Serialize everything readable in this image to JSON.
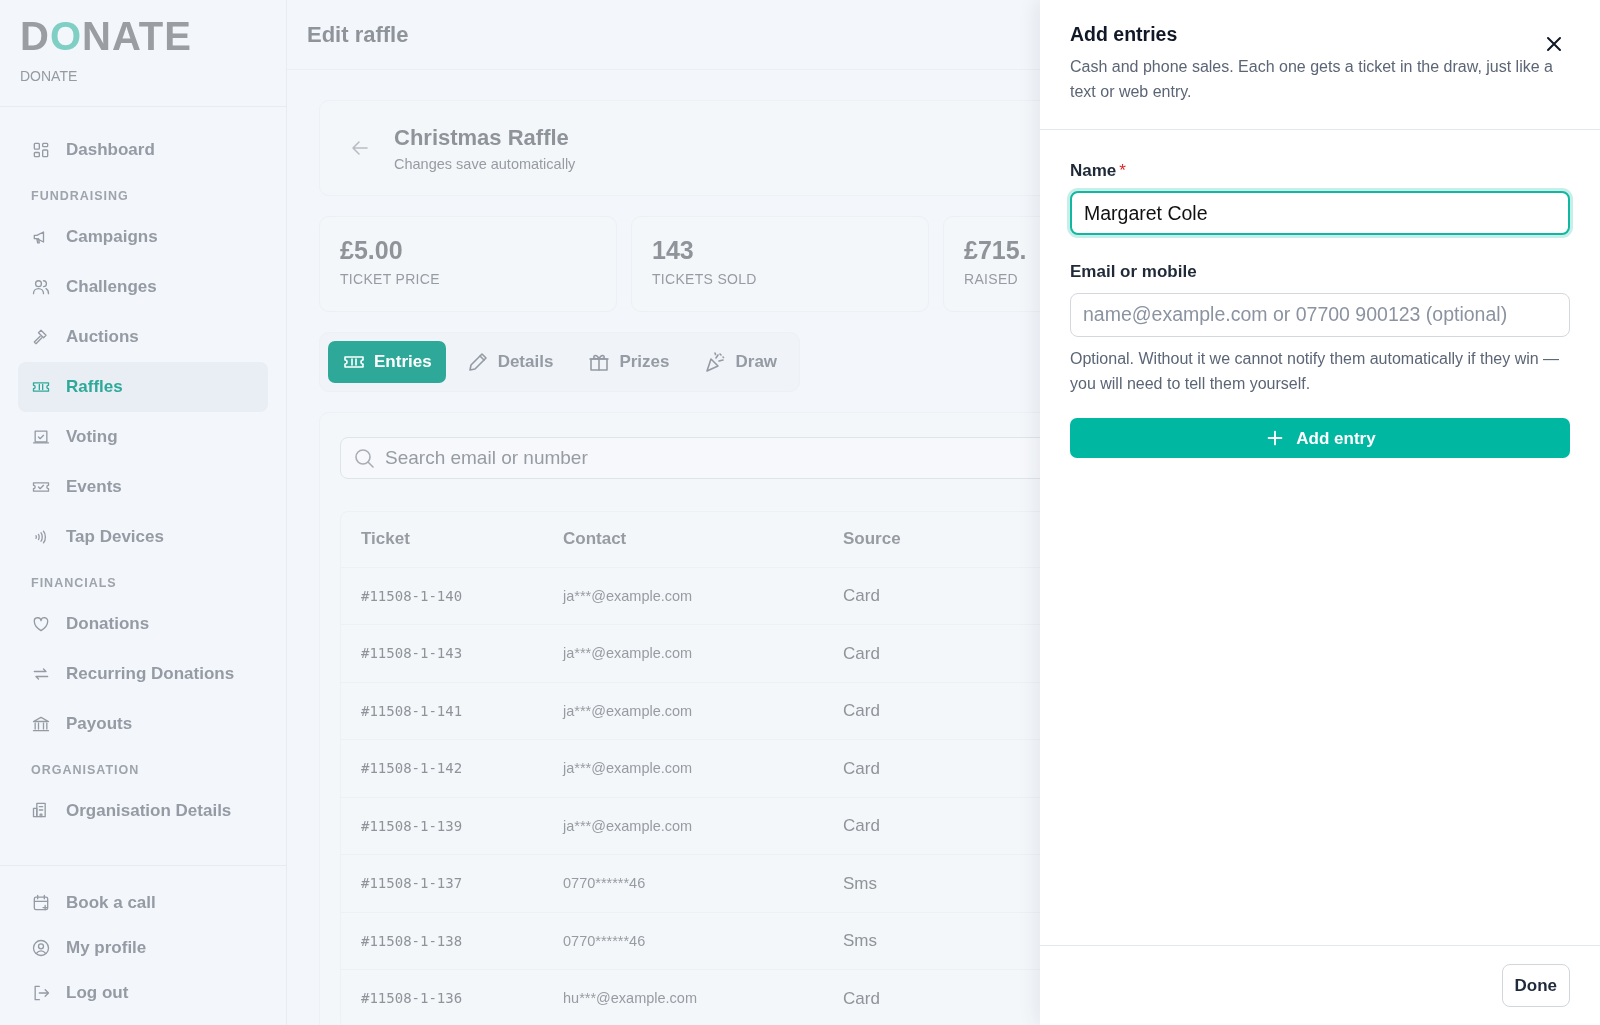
{
  "sidebar": {
    "logo": "DONATE",
    "org_name": "DONATE",
    "groups": [
      {
        "items": [
          {
            "label": "Dashboard",
            "selected": false
          }
        ]
      },
      {
        "heading": "FUNDRAISING",
        "items": [
          {
            "label": "Campaigns",
            "selected": false
          },
          {
            "label": "Challenges",
            "selected": false
          },
          {
            "label": "Auctions",
            "selected": false
          },
          {
            "label": "Raffles",
            "selected": true
          },
          {
            "label": "Voting",
            "selected": false
          },
          {
            "label": "Events",
            "selected": false
          },
          {
            "label": "Tap Devices",
            "selected": false
          }
        ]
      },
      {
        "heading": "FINANCIALS",
        "items": [
          {
            "label": "Donations",
            "selected": false
          },
          {
            "label": "Recurring Donations",
            "selected": false
          },
          {
            "label": "Payouts",
            "selected": false
          }
        ]
      },
      {
        "heading": "ORGANISATION",
        "items": [
          {
            "label": "Organisation Details",
            "selected": false
          }
        ]
      }
    ],
    "bottom_items": [
      {
        "label": "Book a call"
      },
      {
        "label": "My profile"
      },
      {
        "label": "Log out"
      }
    ]
  },
  "header": {
    "title": "Edit raffle"
  },
  "raffle": {
    "title": "Christmas Raffle",
    "subtitle": "Changes save automatically"
  },
  "stats": [
    {
      "value": "£5.00",
      "label": "TICKET PRICE"
    },
    {
      "value": "143",
      "label": "TICKETS SOLD"
    },
    {
      "value": "£715.",
      "label": "RAISED"
    }
  ],
  "tabs": [
    {
      "label": "Entries",
      "selected": true
    },
    {
      "label": "Details",
      "selected": false
    },
    {
      "label": "Prizes",
      "selected": false
    },
    {
      "label": "Draw",
      "selected": false
    }
  ],
  "search": {
    "placeholder": "Search email or number"
  },
  "table": {
    "columns": [
      "Ticket",
      "Contact",
      "Source"
    ],
    "rows": [
      [
        "#11508-1-140",
        "ja***@example.com",
        "Card"
      ],
      [
        "#11508-1-143",
        "ja***@example.com",
        "Card"
      ],
      [
        "#11508-1-141",
        "ja***@example.com",
        "Card"
      ],
      [
        "#11508-1-142",
        "ja***@example.com",
        "Card"
      ],
      [
        "#11508-1-139",
        "ja***@example.com",
        "Card"
      ],
      [
        "#11508-1-137",
        "0770******46",
        "Sms"
      ],
      [
        "#11508-1-138",
        "0770******46",
        "Sms"
      ],
      [
        "#11508-1-136",
        "hu***@example.com",
        "Card"
      ]
    ]
  },
  "drawer": {
    "title": "Add entries",
    "description": "Cash and phone sales. Each one gets a ticket in the draw, just like a text or web entry.",
    "fields": [
      {
        "label": "Name",
        "required_mark": "*",
        "value": "Margaret Cole",
        "focused": true
      },
      {
        "label": "Email or mobile",
        "placeholder": "name@example.com or 07700 900123 (optional)",
        "help": "Optional. Without it we cannot notify them automatically if they win — you will need to tell them yourself.",
        "focused": false
      }
    ],
    "add_button": "Add entry",
    "done_button": "Done"
  }
}
